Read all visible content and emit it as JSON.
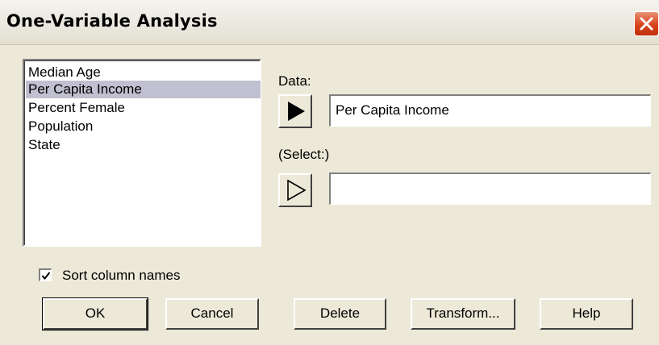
{
  "window": {
    "title": "One-Variable Analysis"
  },
  "columns_list": {
    "items": [
      "Median Age",
      "Per Capita Income",
      "Percent Female",
      "Population",
      "State"
    ],
    "selected": "Per Capita Income"
  },
  "data_field": {
    "label": "Data:",
    "value": "Per Capita Income"
  },
  "select_field": {
    "label": "(Select:)",
    "value": ""
  },
  "sort_option": {
    "label": "Sort column names",
    "checked": true
  },
  "buttons": {
    "ok": "OK",
    "cancel": "Cancel",
    "delete": "Delete",
    "transform": "Transform...",
    "help": "Help"
  },
  "icons": {
    "close": "close-icon",
    "arrow_filled": "arrow-right-filled-icon",
    "arrow_outline": "arrow-right-outline-icon",
    "check": "checkmark-icon"
  }
}
